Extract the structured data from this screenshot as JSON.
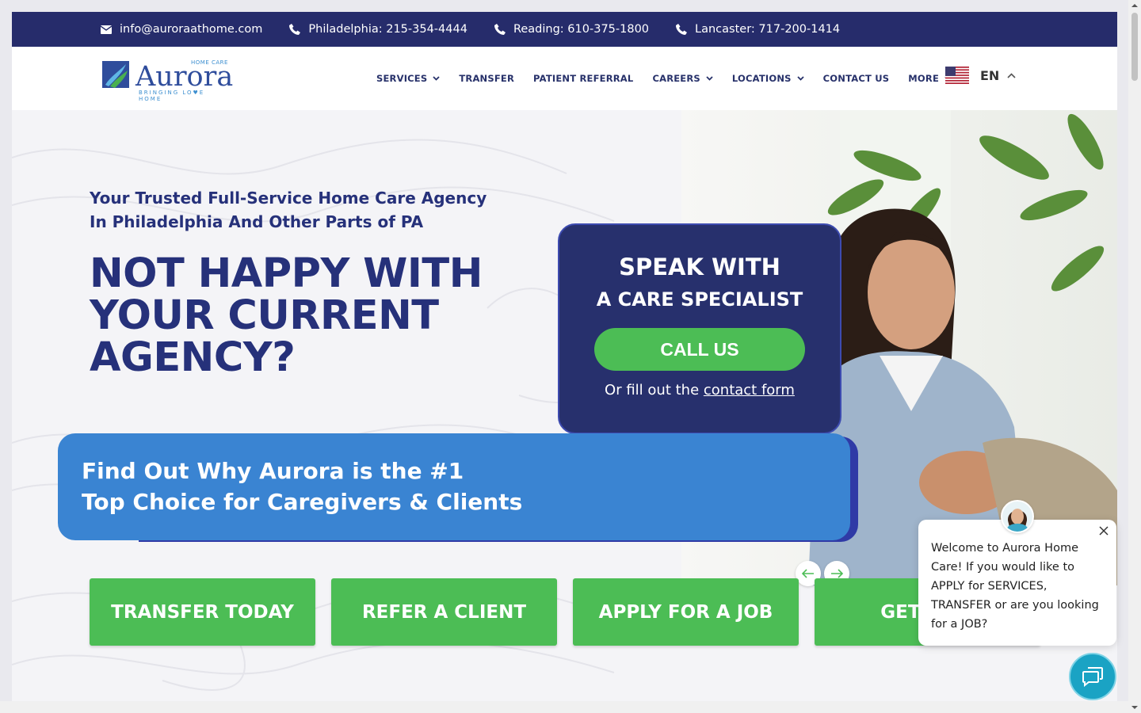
{
  "topbar": {
    "email": "info@auroraathome.com",
    "phones": [
      {
        "label": "Philadelphia: 215-354-4444"
      },
      {
        "label": "Reading: 610-375-1800"
      },
      {
        "label": "Lancaster: 717-200-1414"
      }
    ]
  },
  "logo": {
    "brand": "Aurora",
    "homecare": "HOME CARE",
    "tagline": "BRINGING LO♥E HOME"
  },
  "nav": {
    "items": [
      {
        "label": "SERVICES",
        "dropdown": true
      },
      {
        "label": "TRANSFER",
        "dropdown": false
      },
      {
        "label": "PATIENT REFERRAL",
        "dropdown": false
      },
      {
        "label": "CAREERS",
        "dropdown": true
      },
      {
        "label": "LOCATIONS",
        "dropdown": true
      },
      {
        "label": "CONTACT US",
        "dropdown": false
      },
      {
        "label": "MORE",
        "dropdown": true
      }
    ],
    "language": "EN"
  },
  "hero": {
    "subhead_line1": "Your Trusted Full-Service Home Care Agency",
    "subhead_line2": "In Philadelphia And Other Parts of PA",
    "headline_line1": "NOT HAPPY WITH",
    "headline_line2": "YOUR CURRENT",
    "headline_line3": "AGENCY?",
    "speak": {
      "title1": "SPEAK WITH",
      "title2": "A CARE SPECIALIST",
      "call_label": "CALL US",
      "or_text": "Or fill out the ",
      "link_text": "contact form"
    },
    "banner_line1": "Find Out Why Aurora is the #1",
    "banner_line2": "Top Choice for Caregivers & Clients",
    "ctas": [
      "TRANSFER TODAY",
      "REFER A CLIENT",
      "APPLY FOR A JOB",
      "GET PAID"
    ]
  },
  "chat": {
    "message": "Welcome to Aurora Home Care! If you would like to APPLY for SERVICES, TRANSFER or are you looking for a JOB?"
  },
  "colors": {
    "navy": "#262c6b",
    "green": "#4cbd55",
    "blue": "#3a84d2",
    "chat": "#1aa3c4"
  }
}
